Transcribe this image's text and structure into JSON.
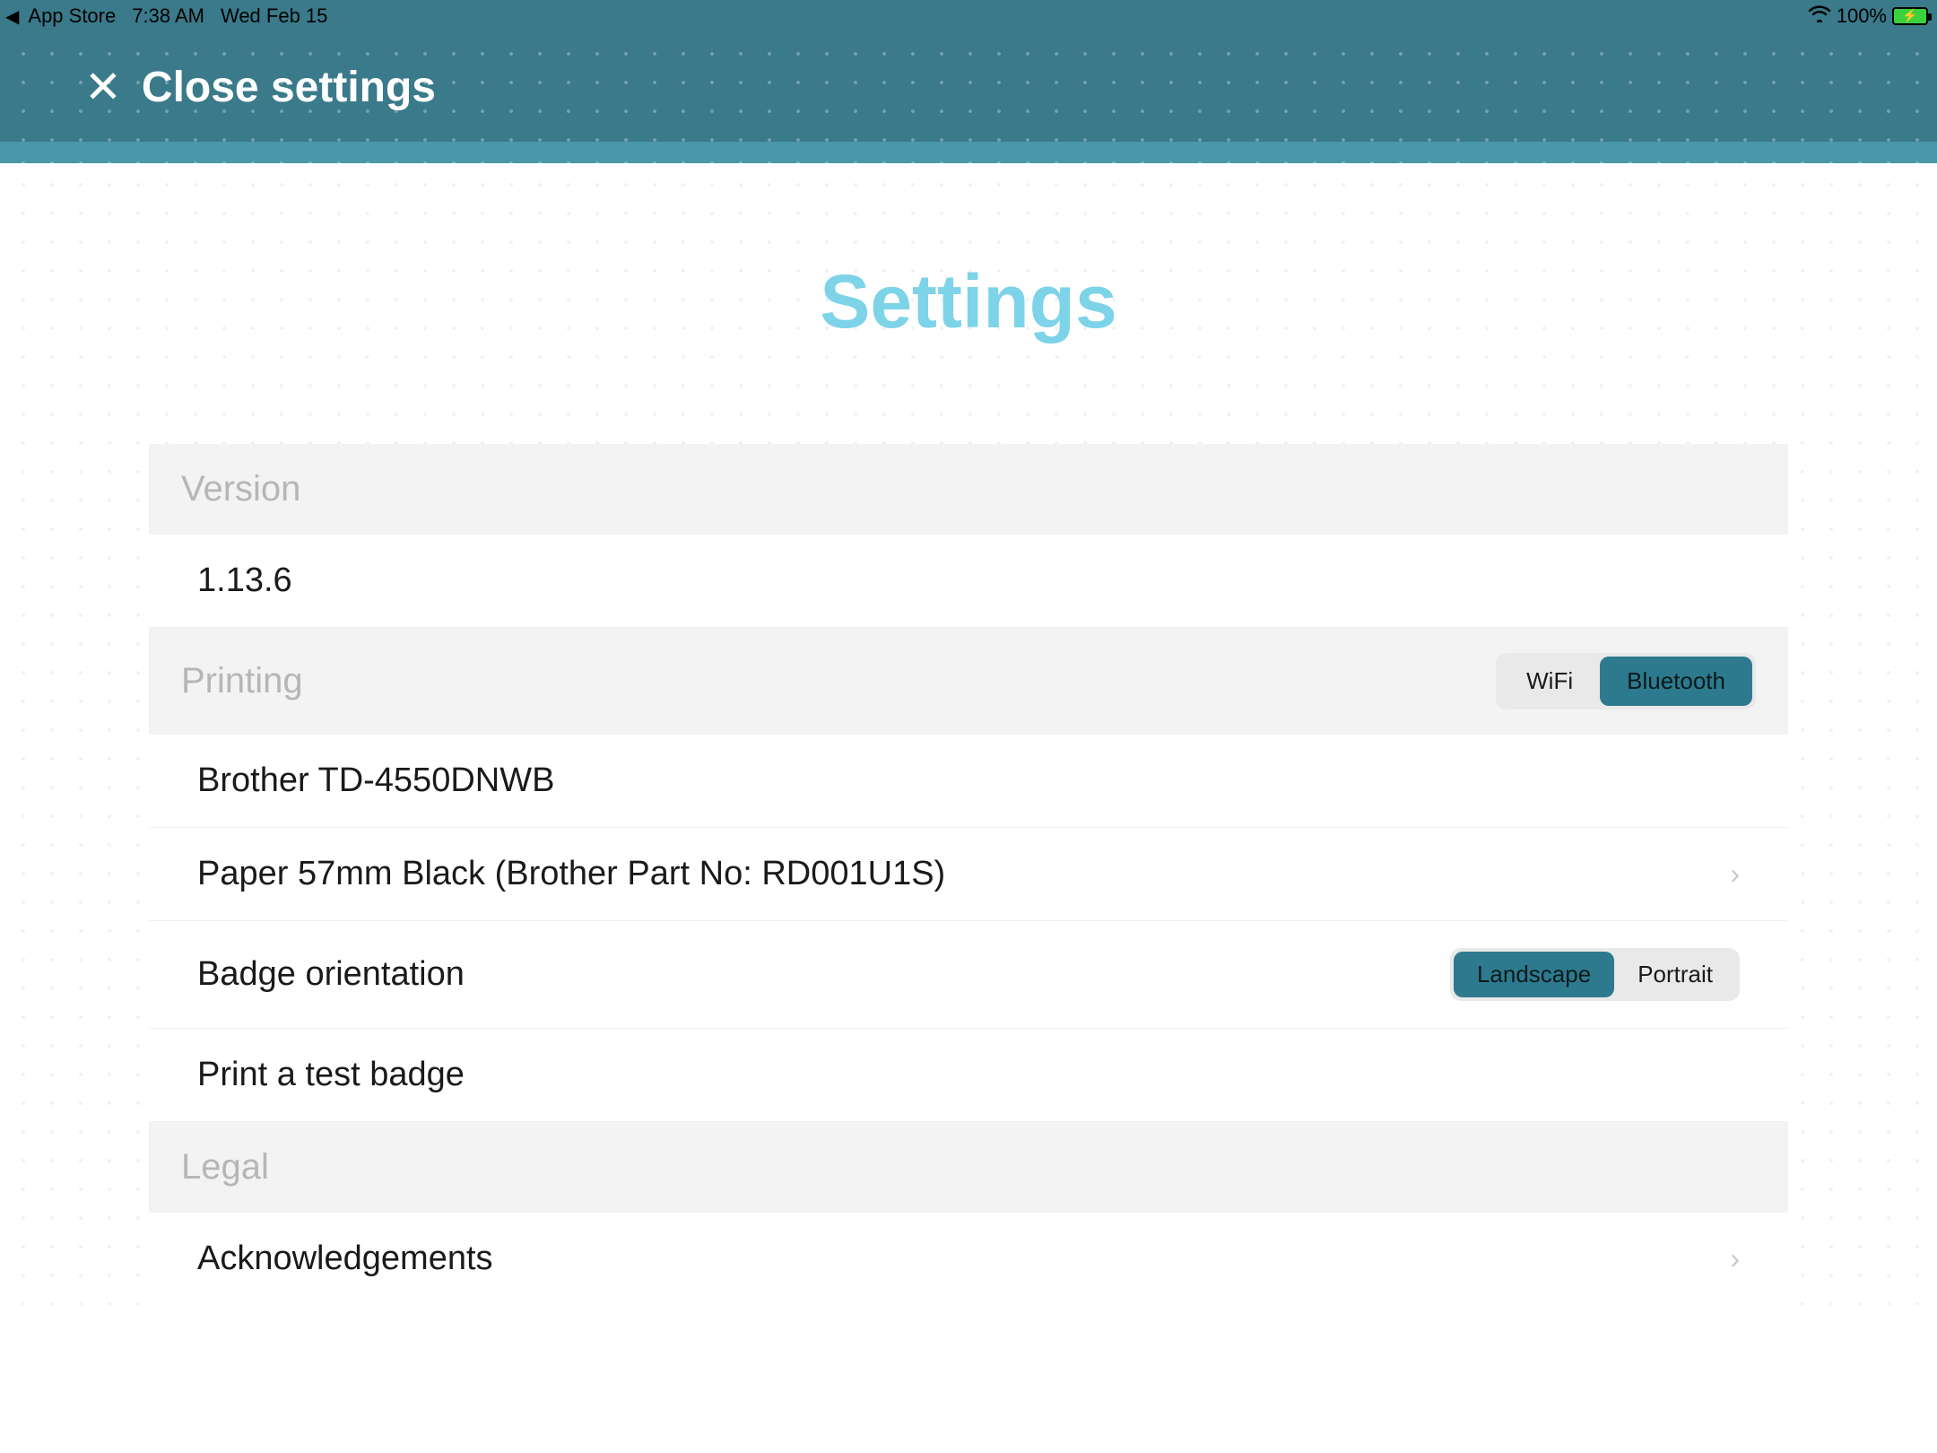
{
  "status_bar": {
    "back_label": "App Store",
    "time": "7:38 AM",
    "date": "Wed Feb 15",
    "battery_pct": "100%"
  },
  "header": {
    "close_label": "Close settings"
  },
  "page": {
    "title": "Settings"
  },
  "sections": {
    "version": {
      "header": "Version",
      "value": "1.13.6"
    },
    "printing": {
      "header": "Printing",
      "connection_options": {
        "wifi": "WiFi",
        "bluetooth": "Bluetooth"
      },
      "connection_selected": "bluetooth",
      "printer": "Brother TD-4550DNWB",
      "paper": "Paper 57mm Black (Brother Part No: RD001U1S)",
      "orientation_label": "Badge orientation",
      "orientation_options": {
        "landscape": "Landscape",
        "portrait": "Portrait"
      },
      "orientation_selected": "landscape",
      "test_badge": "Print a test badge"
    },
    "legal": {
      "header": "Legal",
      "acknowledgements": "Acknowledgements"
    }
  }
}
